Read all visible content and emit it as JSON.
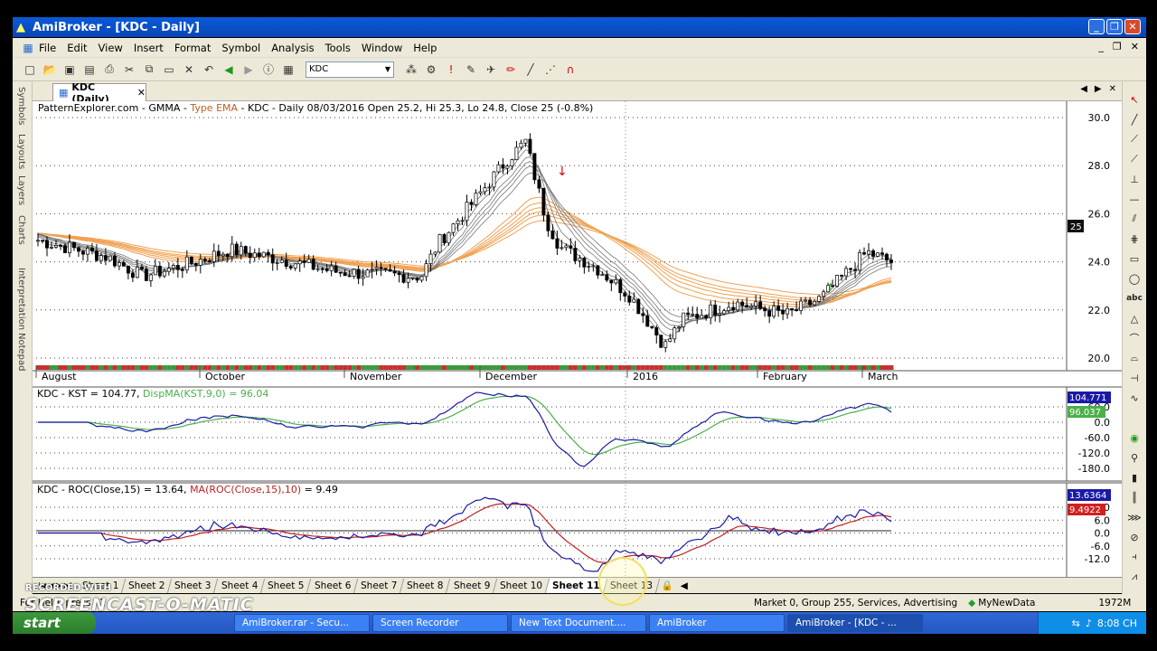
{
  "window": {
    "title": "AmiBroker - [KDC - Daily]"
  },
  "menu": [
    "File",
    "Edit",
    "View",
    "Insert",
    "Format",
    "Symbol",
    "Analysis",
    "Tools",
    "Window",
    "Help"
  ],
  "toolbar": {
    "symbol": "KDC"
  },
  "left_rail": [
    "Symbols",
    "Layouts",
    "Layers",
    "Charts",
    "Interpretation",
    "Notepad"
  ],
  "doc_tab": {
    "label": "KDC (Daily)"
  },
  "price_pane": {
    "title_prefix": "PatternExplorer.com - GMMA - ",
    "title_type": "Type EMA",
    "title_rest": " - KDC - Daily 08/03/2016 Open 25.2, Hi 25.3, Lo 24.8, Close 25 (-0.8%)",
    "y_ticks": [
      "30.0",
      "28.0",
      "26.0",
      "24.0",
      "22.0",
      "20.0"
    ],
    "last_price": "25",
    "months": [
      "August",
      "October",
      "November",
      "December",
      "2016",
      "February",
      "March"
    ]
  },
  "kst_pane": {
    "title_prefix": "KDC - KST",
    "title_value": " = 104.77, ",
    "title_ma": "DispMA(KST,9,0) = 96.04",
    "y_ticks": [
      "60.0",
      "0.0",
      "-60.0",
      "-120.0",
      "-180.0"
    ],
    "value_tag": "104.771",
    "ma_tag": "96.037",
    "blue_color": "#1a1aa6",
    "green_color": "#4ab04a"
  },
  "roc_pane": {
    "title_prefix": "KDC - ROC(Close,15)",
    "title_value": " = 13.64, ",
    "title_ma": "MA(ROC(Close,15),10)",
    "title_ma_value": " = 9.49",
    "y_ticks": [
      "12.0",
      "6.0",
      "0.0",
      "-6.0",
      "-12.0"
    ],
    "value_tag": "13.6364",
    "ma_tag": "9.4922",
    "blue_color": "#1a1aa6",
    "red_color": "#c02020"
  },
  "sheets": [
    "Sheet 1",
    "Sheet 2",
    "Sheet 3",
    "Sheet 4",
    "Sheet 5",
    "Sheet 6",
    "Sheet 7",
    "Sheet 8",
    "Sheet 9",
    "Sheet 10",
    "Sheet 11",
    "Sheet 13"
  ],
  "active_sheet": "Sheet 11",
  "status": {
    "help": "For Help, press F1",
    "market": "Market 0, Group 255, Services, Advertising",
    "db": "MyNewData",
    "mem": "1972M"
  },
  "taskbar": {
    "start": "start",
    "tasks": [
      "AmiBroker.rar - Secu...",
      "Screen Recorder",
      "New Text Document....",
      "AmiBroker",
      "AmiBroker - [KDC - ..."
    ],
    "clock": "8:08 CH"
  },
  "watermark": {
    "line1": "RECORDED WITH",
    "line2": "SCREENCAST-O-MATIC"
  }
}
